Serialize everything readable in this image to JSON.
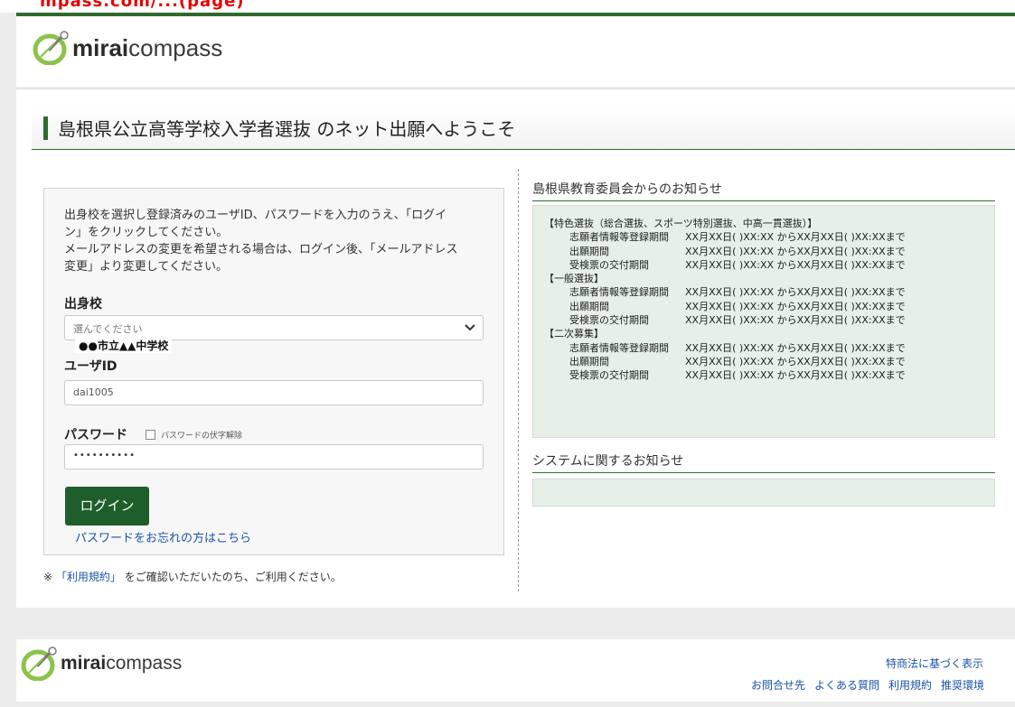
{
  "caption": "mpass.com/...(page)",
  "brand": {
    "name_bold": "mirai",
    "name_rest": "compass"
  },
  "page_title": "島根県公立高等学校入学者選抜 のネット出願へようこそ",
  "login": {
    "intro_lines": [
      "出身校を選択し登録済みのユーザID、パスワードを入力のうえ、「ログイ",
      "ン」をクリックしてください。",
      "メールアドレスの変更を希望される場合は、ログイン後、「メールアドレス",
      "変更」より変更してください。"
    ],
    "school_label": "出身校",
    "school_placeholder": "選んでください",
    "school_value": "●●市立▲▲中学校",
    "userid_label": "ユーザID",
    "userid_value": "dai1005",
    "password_label": "パスワード",
    "password_toggle_label": "パスワードの伏字解除",
    "password_value": "••••••••••",
    "login_button": "ログイン",
    "forgot_link": "パスワードをお忘れの方はこちら"
  },
  "terms": {
    "prefix": "※ ",
    "link": "「利用規約」",
    "suffix": " をご確認いただいたのち、ご利用ください。"
  },
  "board_notice": {
    "heading": "島根県教育委員会からのお知らせ",
    "sections": [
      {
        "title": "【特色選抜（総合選抜、スポーツ特別選抜、中高一貫選抜）】",
        "rows": [
          {
            "label": "志願者情報等登録期間",
            "period": "XX月XX日( )XX:XX からXX月XX日( )XX:XXまで"
          },
          {
            "label": "出願期間",
            "period": "XX月XX日( )XX:XX からXX月XX日( )XX:XXまで"
          },
          {
            "label": "受検票の交付期間",
            "period": "XX月XX日( )XX:XX からXX月XX日( )XX:XXまで"
          }
        ]
      },
      {
        "title": "【一般選抜】",
        "rows": [
          {
            "label": "志願者情報等登録期間",
            "period": "XX月XX日( )XX:XX からXX月XX日( )XX:XXまで"
          },
          {
            "label": "出願期間",
            "period": "XX月XX日( )XX:XX からXX月XX日( )XX:XXまで"
          },
          {
            "label": "受検票の交付期間",
            "period": "XX月XX日( )XX:XX からXX月XX日( )XX:XXまで"
          }
        ]
      },
      {
        "title": "【二次募集】",
        "rows": [
          {
            "label": "志願者情報等登録期間",
            "period": "XX月XX日( )XX:XX からXX月XX日( )XX:XXまで"
          },
          {
            "label": "出願期間",
            "period": "XX月XX日( )XX:XX からXX月XX日( )XX:XXまで"
          },
          {
            "label": "受検票の交付期間",
            "period": "XX月XX日( )XX:XX からXX月XX日( )XX:XXまで"
          }
        ]
      }
    ]
  },
  "system_notice": {
    "heading": "システムに関するお知らせ"
  },
  "footer": {
    "legal": "特商法に基づく表示",
    "links": [
      "お問合せ先",
      "よくある質問",
      "利用規約",
      "推奨環境"
    ]
  },
  "colors": {
    "brand_green": "#2f6b2f",
    "button_green": "#1d5e2a",
    "notice_bg": "#e6f0e6",
    "link_blue": "#1a55a8",
    "caption_red": "#e60000"
  },
  "icons": [
    "compass-logo-icon",
    "chevron-down-icon",
    "checkbox-icon"
  ]
}
